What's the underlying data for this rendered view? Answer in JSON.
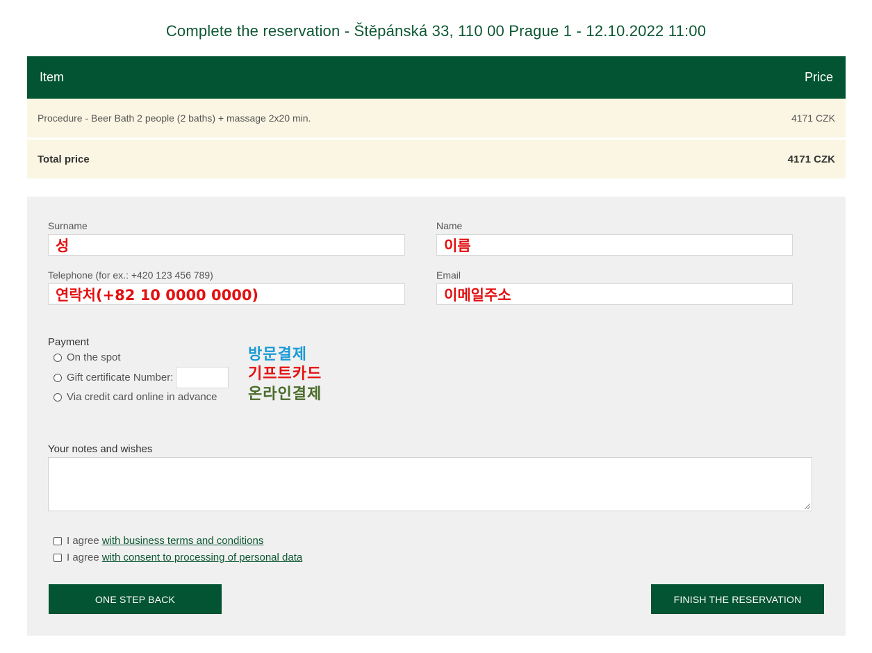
{
  "page": {
    "title": "Complete the reservation - Štěpánská 33, 110 00 Prague 1 - 12.10.2022 11:00"
  },
  "order": {
    "headers": {
      "item": "Item",
      "price": "Price"
    },
    "rows": [
      {
        "item": "Procedure - Beer Bath 2 people (2 baths) + massage 2x20 min.",
        "price": "4171 CZK"
      }
    ],
    "total": {
      "label": "Total price",
      "value": "4171 CZK"
    }
  },
  "form": {
    "surname": {
      "label": "Surname",
      "value": "성"
    },
    "name": {
      "label": "Name",
      "value": "이름"
    },
    "telephone": {
      "label": "Telephone (for ex.: +420 123 456 789)",
      "value": "연락처(+82 10 0000 0000)"
    },
    "email": {
      "label": "Email",
      "value": "이메일주소"
    },
    "payment": {
      "title": "Payment",
      "options": [
        {
          "label": "On the spot",
          "annotation": "방문결제",
          "annotation_color": "#1a9ad6"
        },
        {
          "label": "Gift certificate Number:",
          "annotation": "기프트카드",
          "annotation_color": "#e31010"
        },
        {
          "label": "Via credit card online in advance",
          "annotation": "온라인결제",
          "annotation_color": "#4a6b28"
        }
      ]
    },
    "notes": {
      "label": "Your notes and wishes",
      "value": ""
    },
    "agreements": [
      {
        "prefix": "I agree",
        "link": "with business terms and conditions"
      },
      {
        "prefix": "I agree",
        "link": "with consent to processing of personal data"
      }
    ],
    "buttons": {
      "back": "ONE STEP BACK",
      "finish": "FINISH THE RESERVATION"
    }
  },
  "colors": {
    "brand_green": "#035432",
    "row_background": "#fbf6e3",
    "panel_background": "#f0f0f0",
    "annotation_red": "#e31010"
  }
}
